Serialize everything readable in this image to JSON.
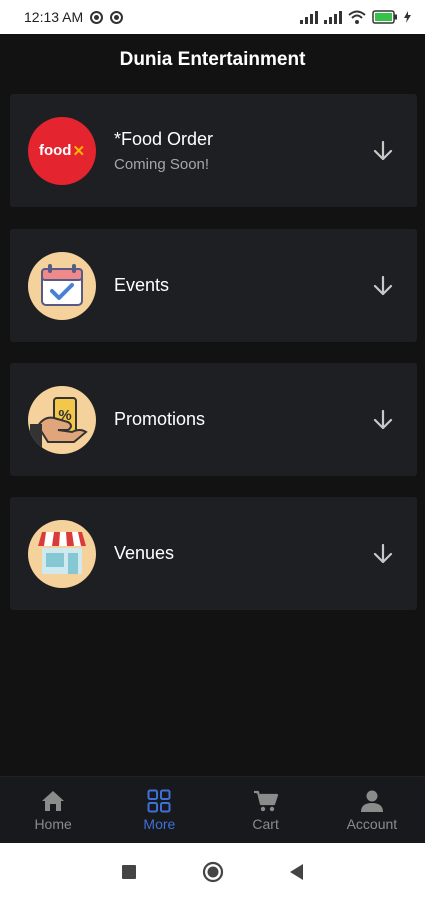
{
  "status_bar": {
    "time": "12:13 AM",
    "icons": [
      "sync-icon",
      "sync-icon",
      "signal-icon",
      "signal-icon",
      "wifi-icon",
      "battery-icon",
      "charging-icon"
    ]
  },
  "header": {
    "title": "Dunia Entertainment"
  },
  "menu": {
    "items": [
      {
        "icon": "food-logo-icon",
        "logo_text": "food",
        "title": "*Food Order",
        "subtitle": "Coming Soon!"
      },
      {
        "icon": "calendar-check-icon",
        "title": "Events"
      },
      {
        "icon": "discount-tag-icon",
        "title": "Promotions"
      },
      {
        "icon": "storefront-icon",
        "title": "Venues"
      }
    ]
  },
  "bottom_nav": {
    "items": [
      {
        "label": "Home",
        "icon": "home-icon"
      },
      {
        "label": "More",
        "icon": "grid-icon",
        "active": true
      },
      {
        "label": "Cart",
        "icon": "cart-icon"
      },
      {
        "label": "Account",
        "icon": "person-icon"
      }
    ]
  },
  "colors": {
    "background": "#121212",
    "card": "#1e1f23",
    "accent": "#3f6fd8",
    "food_red": "#e4242f"
  }
}
